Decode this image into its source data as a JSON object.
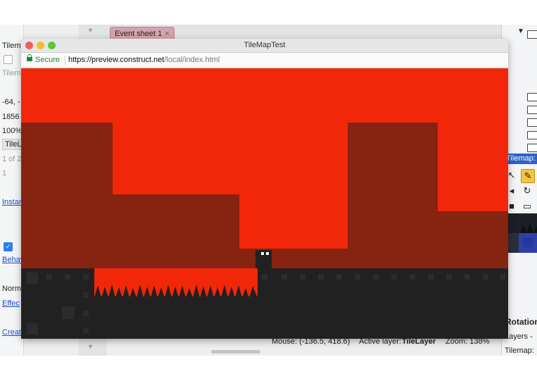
{
  "editor": {
    "left_panel": {
      "rows": [
        "Tilem",
        "Tilem",
        "-64, -",
        "1856",
        "100%",
        "TileL",
        "1 of 2",
        "1",
        "Instan",
        "Behav",
        "Norm",
        "Effec",
        "Creat"
      ]
    },
    "tab": {
      "label": "Event sheet 1",
      "close": "×"
    },
    "right_panel": {
      "tilemap_header": "Tilemap: T",
      "rotation_label": "Rotation",
      "layers_label": "Layers -",
      "tilemap_sub": "Tilemap:"
    },
    "status": {
      "mouse": "Mouse: (-136.5, 418.6)",
      "active_layer_label": "Active layer:",
      "active_layer_value": "TileLayer",
      "zoom": "Zoom: 138%"
    }
  },
  "browser": {
    "window_title": "TileMapTest",
    "secure_label": "Secure",
    "url_host": "https://preview.construct.net",
    "url_path": "/local/index.html",
    "traffic_lights": {
      "close": "#ed5f57",
      "minimize": "#f5bd2e",
      "maximize": "#5fc43f"
    }
  },
  "colors": {
    "sky": "#f2270a",
    "wall": "#872311",
    "ground": "#212121",
    "accent_tool": "#f5c63c",
    "secure_green": "#1f8a3a"
  },
  "icons": {
    "expand": "triangle-down-icon",
    "folder": "folder-icon",
    "tools": [
      "select-arrow-icon",
      "pencil-icon",
      "eraser-icon",
      "rotate-icon",
      "stamp-icon",
      "folder-icon"
    ]
  }
}
